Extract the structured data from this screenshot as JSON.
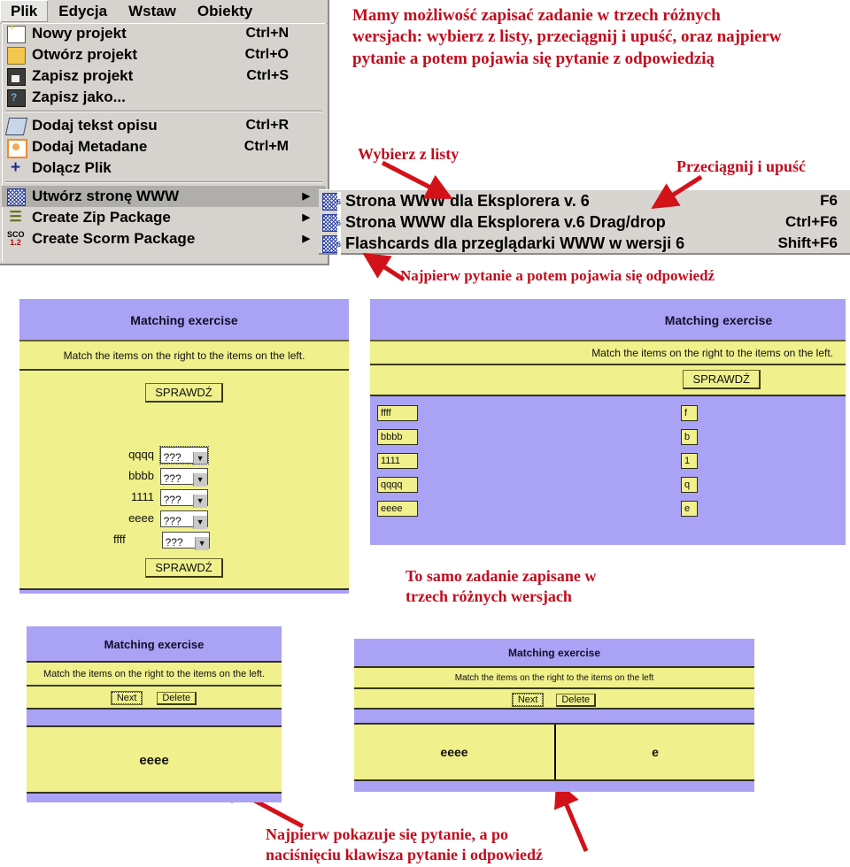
{
  "menubar": {
    "items": [
      {
        "label": "Plik",
        "active": true
      },
      {
        "label": "Edycja",
        "active": false
      },
      {
        "label": "Wstaw",
        "active": false
      },
      {
        "label": "Obiekty",
        "active": false
      }
    ]
  },
  "file_menu": {
    "items": [
      {
        "icon": "new-document-icon",
        "label": "Nowy projekt",
        "accel": "Ctrl+N",
        "arrow": "",
        "highlight": false
      },
      {
        "icon": "open-folder-icon",
        "label": "Otwórz projekt",
        "accel": "Ctrl+O",
        "arrow": "",
        "highlight": false
      },
      {
        "icon": "floppy-disk-icon",
        "label": "Zapisz projekt",
        "accel": "Ctrl+S",
        "arrow": "",
        "highlight": false
      },
      {
        "icon": "save-as-icon",
        "label": "Zapisz jako...",
        "accel": "",
        "arrow": "",
        "highlight": false
      },
      {
        "icon": "book-icon",
        "label": "Dodaj  tekst opisu",
        "accel": "Ctrl+R",
        "arrow": "",
        "highlight": false
      },
      {
        "icon": "metadata-icon",
        "label": "Dodaj Metadane",
        "accel": "Ctrl+M",
        "arrow": "",
        "highlight": false
      },
      {
        "icon": "plus-icon",
        "label": "Dolącz Plik",
        "accel": "",
        "arrow": "",
        "highlight": false
      },
      {
        "icon": "web-page-icon",
        "label": "Utwórz stronę WWW",
        "accel": "",
        "arrow": "▶",
        "highlight": true
      },
      {
        "icon": "zip-package-icon",
        "label": "Create Zip Package",
        "accel": "",
        "arrow": "▶",
        "highlight": false
      },
      {
        "icon": "scorm-package-icon",
        "label": "Create Scorm Package",
        "accel": "",
        "arrow": "▶",
        "highlight": false
      }
    ]
  },
  "submenu": {
    "items": [
      {
        "icon": "web-page-icon",
        "label": "Strona WWW dla Eksplorera v. 6",
        "accel": "F6"
      },
      {
        "icon": "web-dragdrop-icon",
        "label": "Strona WWW dla Eksplorera v.6 Drag/drop",
        "accel": "Ctrl+F6"
      },
      {
        "icon": "flashcards-icon",
        "label": "Flashcards  dla przeglądarki WWW  w wersji 6",
        "accel": "Shift+F6"
      }
    ]
  },
  "annotations": {
    "intro_line1": "Mamy możliwość zapisać zadanie w trzech różnych",
    "intro_line2": "wersjach: wybierz z listy, przeciągnij i upuść, oraz najpierw",
    "intro_line3": "pytanie a potem pojawia się pytanie z odpowiedzią",
    "pick_from_list": "Wybierz z listy",
    "drag_and_drop": "Przeciągnij i upuść",
    "question_then_answer": "Najpierw pytanie a potem pojawia się odpowiedź",
    "same_task_line1": "To samo zadanie zapisane w",
    "same_task_line2": "trzech różnych wersjach",
    "bottom_line1": "Najpierw pokazuje się pytanie, a po",
    "bottom_line2": "naciśnięciu klawisza pytanie i odpowiedź"
  },
  "colors": {
    "accent_red": "#c00d1e",
    "panel_purple": "#aaa2f5",
    "panel_yellow": "#f0f08c",
    "menu_gray": "#d6d3ce",
    "menu_highlight": "#b0aeaa"
  },
  "exercise_select": {
    "title": "Matching exercise",
    "instruction": "Match the items on the right to the items on the left.",
    "check_button": "SPRAWDŹ",
    "rows": [
      {
        "label": "qqqq",
        "value": "???",
        "focused": true
      },
      {
        "label": "bbbb",
        "value": "???",
        "focused": false
      },
      {
        "label": "1111",
        "value": "???",
        "focused": false
      },
      {
        "label": "eeee",
        "value": "???",
        "focused": false
      },
      {
        "label": "ffff",
        "value": "???",
        "focused": false
      }
    ]
  },
  "exercise_dragdrop": {
    "title": "Matching exercise",
    "instruction": "Match the items on the right to the items on the left.",
    "check_button": "SPRAWDŹ",
    "left_items": [
      "ffff",
      "bbbb",
      "1111",
      "qqqq",
      "eeee"
    ],
    "right_items": [
      "f",
      "b",
      "1",
      "q",
      "e"
    ]
  },
  "exercise_flashcard_left": {
    "title": "Matching exercise",
    "instruction": "Match the items on the right to the items on the left.",
    "next_button": "Next",
    "delete_button": "Delete",
    "card_front": "eeee"
  },
  "exercise_flashcard_right": {
    "title": "Matching exercise",
    "instruction": "Match the items on the right to the items on the left",
    "next_button": "Next",
    "delete_button": "Delete",
    "card_question": "eeee",
    "card_answer": "e"
  }
}
